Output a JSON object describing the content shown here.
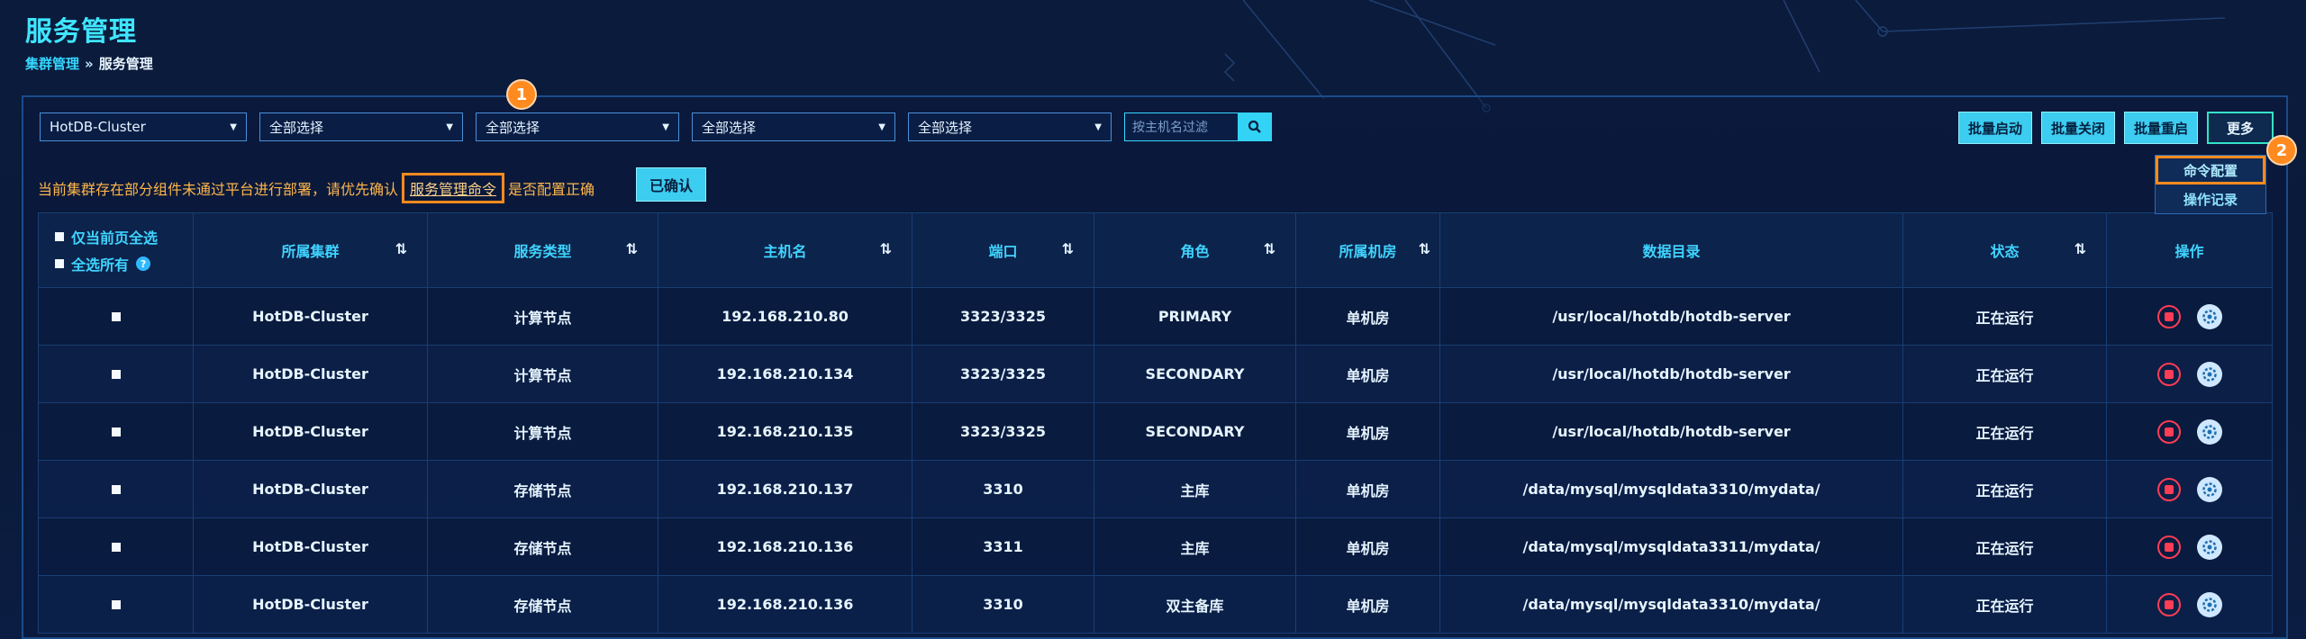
{
  "page": {
    "title": "服务管理",
    "breadcrumb": {
      "parent": "集群管理",
      "separator": "»",
      "current": "服务管理"
    }
  },
  "filters": {
    "cluster": "HotDB-Cluster",
    "select2": "全部选择",
    "select3": "全部选择",
    "select4": "全部选择",
    "select5": "全部选择",
    "search_placeholder": "按主机名过滤"
  },
  "actions": {
    "batch_start": "批量启动",
    "batch_stop": "批量关闭",
    "batch_restart": "批量重启",
    "more": "更多",
    "more_menu": [
      "命令配置",
      "操作记录"
    ]
  },
  "notice": {
    "prefix": "当前集群存在部分组件未通过平台进行部署，请优先确认",
    "link": "服务管理命令",
    "suffix": "是否配置正确",
    "confirm": "已确认"
  },
  "annotations": [
    "1",
    "2"
  ],
  "table": {
    "select_current_page": "仅当前页全选",
    "select_all": "全选所有",
    "help_icon": "?",
    "columns": [
      "所属集群",
      "服务类型",
      "主机名",
      "端口",
      "角色",
      "所属机房",
      "数据目录",
      "状态",
      "操作"
    ],
    "rows": [
      {
        "cluster": "HotDB-Cluster",
        "type": "计算节点",
        "host": "192.168.210.80",
        "port": "3323/3325",
        "role": "PRIMARY",
        "room": "单机房",
        "dir": "/usr/local/hotdb/hotdb-server",
        "status": "正在运行"
      },
      {
        "cluster": "HotDB-Cluster",
        "type": "计算节点",
        "host": "192.168.210.134",
        "port": "3323/3325",
        "role": "SECONDARY",
        "room": "单机房",
        "dir": "/usr/local/hotdb/hotdb-server",
        "status": "正在运行"
      },
      {
        "cluster": "HotDB-Cluster",
        "type": "计算节点",
        "host": "192.168.210.135",
        "port": "3323/3325",
        "role": "SECONDARY",
        "room": "单机房",
        "dir": "/usr/local/hotdb/hotdb-server",
        "status": "正在运行"
      },
      {
        "cluster": "HotDB-Cluster",
        "type": "存储节点",
        "host": "192.168.210.137",
        "port": "3310",
        "role": "主库",
        "room": "单机房",
        "dir": "/data/mysql/mysqldata3310/mydata/",
        "status": "正在运行"
      },
      {
        "cluster": "HotDB-Cluster",
        "type": "存储节点",
        "host": "192.168.210.136",
        "port": "3311",
        "role": "主库",
        "room": "单机房",
        "dir": "/data/mysql/mysqldata3311/mydata/",
        "status": "正在运行"
      },
      {
        "cluster": "HotDB-Cluster",
        "type": "存储节点",
        "host": "192.168.210.136",
        "port": "3310",
        "role": "双主备库",
        "room": "单机房",
        "dir": "/data/mysql/mysqldata3310/mydata/",
        "status": "正在运行"
      }
    ]
  },
  "colors": {
    "accent": "#3fd4ff",
    "running": "#23f07a",
    "highlight": "#ff8a1f",
    "stop": "#ff3d55"
  }
}
